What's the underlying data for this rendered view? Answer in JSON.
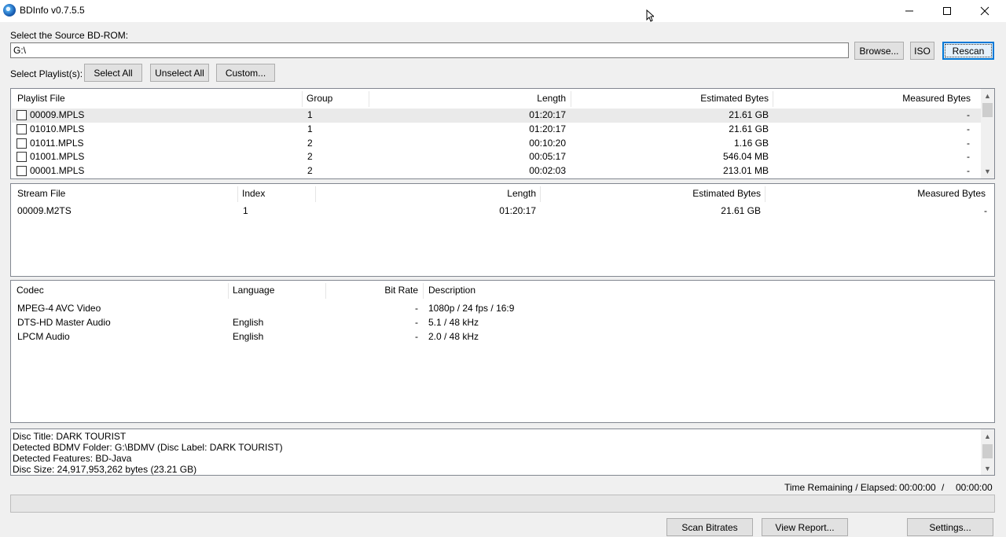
{
  "window": {
    "title": "BDInfo v0.7.5.5"
  },
  "source": {
    "label": "Select the Source BD-ROM:",
    "path": "G:\\",
    "browse_label": "Browse...",
    "iso_label": "ISO",
    "rescan_label": "Rescan"
  },
  "playlist_select": {
    "label": "Select Playlist(s):",
    "select_all_label": "Select All",
    "unselect_all_label": "Unselect All",
    "custom_label": "Custom..."
  },
  "playlists": {
    "headers": [
      "Playlist File",
      "Group",
      "Length",
      "Estimated Bytes",
      "Measured Bytes"
    ],
    "rows": [
      {
        "file": "00009.MPLS",
        "group": "1",
        "length": "01:20:17",
        "estimated": "21.61 GB",
        "measured": "-"
      },
      {
        "file": "01010.MPLS",
        "group": "1",
        "length": "01:20:17",
        "estimated": "21.61 GB",
        "measured": "-"
      },
      {
        "file": "01011.MPLS",
        "group": "2",
        "length": "00:10:20",
        "estimated": "1.16 GB",
        "measured": "-"
      },
      {
        "file": "01001.MPLS",
        "group": "2",
        "length": "00:05:17",
        "estimated": "546.04 MB",
        "measured": "-"
      },
      {
        "file": "00001.MPLS",
        "group": "2",
        "length": "00:02:03",
        "estimated": "213.01 MB",
        "measured": "-"
      }
    ]
  },
  "streams": {
    "headers": [
      "Stream File",
      "Index",
      "Length",
      "Estimated Bytes",
      "Measured Bytes"
    ],
    "rows": [
      {
        "file": "00009.M2TS",
        "index": "1",
        "length": "01:20:17",
        "estimated": "21.61 GB",
        "measured": "-"
      }
    ]
  },
  "codecs": {
    "headers": [
      "Codec",
      "Language",
      "Bit Rate",
      "Description"
    ],
    "rows": [
      {
        "codec": "MPEG-4 AVC Video",
        "language": "",
        "bitrate": "-",
        "description": "1080p / 24 fps / 16:9"
      },
      {
        "codec": "DTS-HD Master Audio",
        "language": "English",
        "bitrate": "-",
        "description": "5.1 / 48 kHz"
      },
      {
        "codec": "LPCM Audio",
        "language": "English",
        "bitrate": "-",
        "description": "2.0 / 48 kHz"
      }
    ]
  },
  "log": {
    "lines": [
      "Disc Title: DARK TOURIST",
      "Detected BDMV Folder: G:\\BDMV (Disc Label: DARK TOURIST)",
      "Detected Features: BD-Java",
      "Disc Size: 24,917,953,262 bytes (23.21 GB)"
    ]
  },
  "status": {
    "time_label": "Time Remaining / Elapsed:",
    "remaining": "00:00:00",
    "separator": "/",
    "elapsed": "00:00:00",
    "progress_fraction": 0
  },
  "actions": {
    "scan_label": "Scan Bitrates",
    "report_label": "View Report...",
    "settings_label": "Settings..."
  },
  "icons": {
    "minimize": "minimize-icon",
    "maximize": "maximize-icon",
    "close": "close-icon",
    "scroll_up": "scroll-up-icon",
    "scroll_down": "scroll-down-icon"
  },
  "colors": {
    "accent": "#0078d7",
    "row_highlight": "#eaeaea"
  }
}
